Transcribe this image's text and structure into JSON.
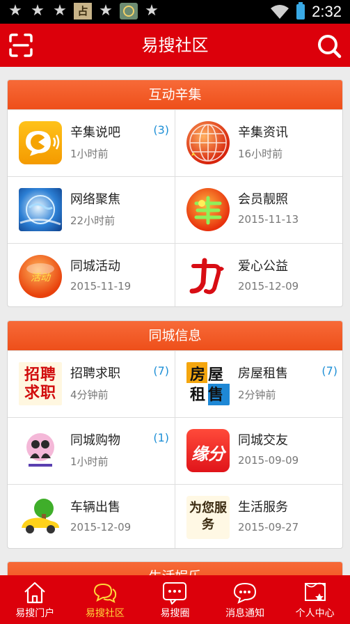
{
  "status_bar": {
    "time": "2:32",
    "box_glyph": "占"
  },
  "header": {
    "title": "易搜社区"
  },
  "sections": [
    {
      "title": "互动辛集",
      "items": [
        {
          "title": "辛集说吧",
          "subtitle": "1小时前",
          "badge": "(3)",
          "icon": "chat-bubble-icon"
        },
        {
          "title": "辛集资讯",
          "subtitle": "16小时前",
          "badge": "",
          "icon": "globe-news-icon"
        },
        {
          "title": "网络聚焦",
          "subtitle": "22小时前",
          "badge": "",
          "icon": "earth-focus-icon"
        },
        {
          "title": "会员靓照",
          "subtitle": "2015-11-13",
          "badge": "",
          "icon": "member-photo-icon"
        },
        {
          "title": "同城活动",
          "subtitle": "2015-11-19",
          "badge": "",
          "icon": "activity-icon",
          "icon_text": "活动"
        },
        {
          "title": "爱心公益",
          "subtitle": "2015-12-09",
          "badge": "",
          "icon": "charity-icon"
        }
      ]
    },
    {
      "title": "同城信息",
      "items": [
        {
          "title": "招聘求职",
          "subtitle": "4分钟前",
          "badge": "(7)",
          "icon": "recruit-icon",
          "icon_text": "招聘求职"
        },
        {
          "title": "房屋租售",
          "subtitle": "2分钟前",
          "badge": "(7)",
          "icon": "house-icon",
          "icon_text": "房屋租售"
        },
        {
          "title": "同城购物",
          "subtitle": "1小时前",
          "badge": "(1)",
          "icon": "shopping-icon"
        },
        {
          "title": "同城交友",
          "subtitle": "2015-09-09",
          "badge": "",
          "icon": "friends-icon",
          "icon_text": "缘分"
        },
        {
          "title": "车辆出售",
          "subtitle": "2015-12-09",
          "badge": "",
          "icon": "car-icon"
        },
        {
          "title": "生活服务",
          "subtitle": "2015-09-27",
          "badge": "",
          "icon": "service-icon",
          "icon_text": "为您服务"
        }
      ]
    },
    {
      "title": "生活娱乐"
    }
  ],
  "tabs": [
    {
      "label": "易搜门户",
      "icon": "home-icon",
      "active": false
    },
    {
      "label": "易搜社区",
      "icon": "community-icon",
      "active": true
    },
    {
      "label": "易搜圈",
      "icon": "circle-icon",
      "active": false
    },
    {
      "label": "消息通知",
      "icon": "message-icon",
      "active": false
    },
    {
      "label": "个人中心",
      "icon": "profile-icon",
      "active": false
    }
  ],
  "colors": {
    "brand_red": "#dc000b",
    "section_orange": "#f15a24",
    "badge_blue": "#1d8fd6",
    "active_tab": "#ffd93b"
  }
}
